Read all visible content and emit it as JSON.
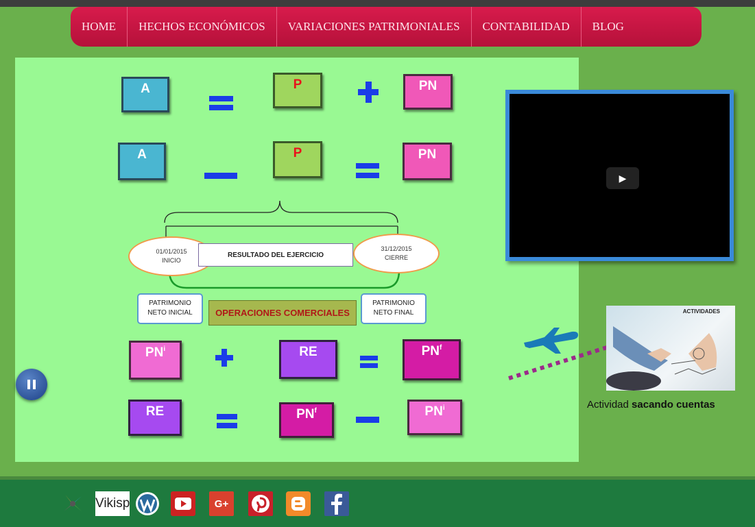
{
  "nav": {
    "items": [
      "HOME",
      "HECHOS ECONÓMICOS",
      "VARIACIONES PATRIMONIALES",
      "CONTABILIDAD",
      "BLOG"
    ]
  },
  "diagram": {
    "row1": {
      "a": "A",
      "p": "P",
      "pn": "PN"
    },
    "row2": {
      "a": "A",
      "p": "P",
      "pn": "PN"
    },
    "start_date": "01/01/2015",
    "start_label": "INICIO",
    "end_date": "31/12/2015",
    "end_label": "CIERRE",
    "resultado": "RESULTADO DEL EJERCICIO",
    "pn_inicial_line1": "PATRIMONIO",
    "pn_inicial_line2": "NETO INICIAL",
    "operaciones": "OPERACIONES COMERCIALES",
    "pn_final_line1": "PATRIMONIO",
    "pn_final_line2": "NETO FINAL",
    "row3": {
      "pn": "PN",
      "pn_sub": "i",
      "re": "RE",
      "pnf": "PN",
      "pnf_sub": "f"
    },
    "row4": {
      "re": "RE",
      "pnf": "PN",
      "pnf_sub": "f",
      "pni": "PN",
      "pni_sub": "i"
    }
  },
  "activity": {
    "image_title": "ACTIVIDADES",
    "caption_prefix": "Actividad ",
    "caption_bold": "sacando cuentas"
  },
  "social": {
    "wikispaces_text": "Vikisp",
    "google_plus": "G+"
  },
  "colors": {
    "nav_bg": "#c8174a",
    "page_bg": "#6ab04c",
    "canvas_bg": "#99f993",
    "footer_bg": "#1e7a3e",
    "video_border": "#3a8ad9",
    "operator": "#1a3de8"
  },
  "icons": [
    "play-icon",
    "pause-icon",
    "airplane-icon",
    "wikispaces-icon",
    "wordpress-icon",
    "youtube-icon",
    "google-plus-icon",
    "pinterest-icon",
    "blogger-icon",
    "facebook-icon"
  ]
}
